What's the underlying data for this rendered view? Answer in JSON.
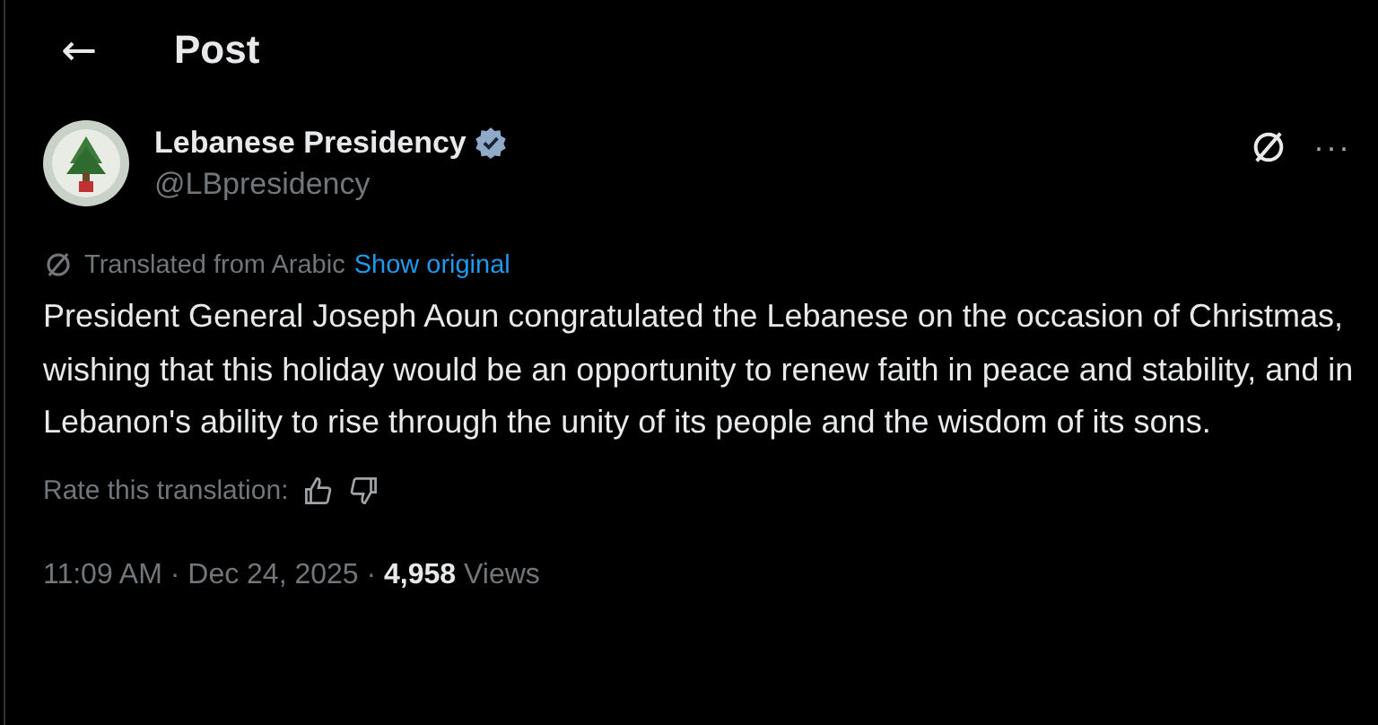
{
  "header": {
    "back_icon": "←",
    "title": "Post"
  },
  "author": {
    "name": "Lebanese Presidency",
    "verified": true,
    "handle": "@LBpresidency",
    "more": "···"
  },
  "translation": {
    "note": "Translated from Arabic",
    "link": "Show original"
  },
  "body": "President General Joseph Aoun congratulated the Lebanese on the occasion of Christmas, wishing that this holiday would be an opportunity to renew faith in peace and stability, and in Lebanon's ability to rise through the unity of its people and the wisdom of its sons.",
  "rate": {
    "label": "Rate this translation:"
  },
  "meta": "11:09 AM · Dec 24, 2025 · **4,958** Views"
}
